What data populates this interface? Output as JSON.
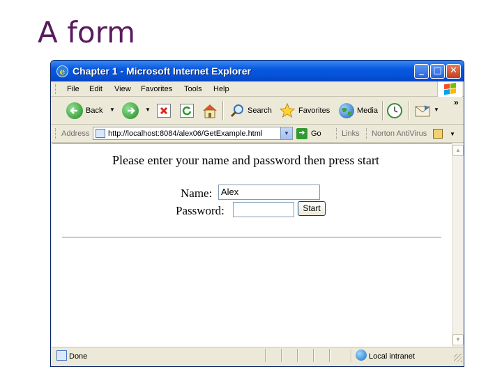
{
  "slide": {
    "title": "A form"
  },
  "window": {
    "title": "Chapter 1 - Microsoft Internet Explorer",
    "controls": {
      "minimize": "_",
      "maximize": "□",
      "close": "✕"
    }
  },
  "menubar": {
    "items": [
      {
        "label": "File"
      },
      {
        "label": "Edit"
      },
      {
        "label": "View"
      },
      {
        "label": "Favorites"
      },
      {
        "label": "Tools"
      },
      {
        "label": "Help"
      }
    ]
  },
  "toolbar": {
    "back_label": "Back",
    "search_label": "Search",
    "favorites_label": "Favorites",
    "media_label": "Media",
    "overflow": "»",
    "dropdown_glyph": "▼"
  },
  "addressbar": {
    "label": "Address",
    "url": "http://localhost:8084/alex06/GetExample.html",
    "dropdown_glyph": "▼",
    "go_label": "Go",
    "go_glyph": "➔",
    "links_label": "Links",
    "norton_label": "Norton AntiVirus",
    "norton_dropdown_glyph": "▼"
  },
  "page": {
    "prompt": "Please enter your name and password then press start",
    "name_label": "Name:",
    "name_value": "Alex",
    "password_label": "Password:",
    "password_value": "",
    "start_label": "Start"
  },
  "scrollbar": {
    "up_glyph": "▲",
    "down_glyph": "▼"
  },
  "statusbar": {
    "status": "Done",
    "zone": "Local intranet"
  },
  "colors": {
    "slide_title": "#5a1a5e",
    "titlebar": "#0858e0",
    "chrome": "#ece9d8",
    "close_button": "#c3411d"
  }
}
